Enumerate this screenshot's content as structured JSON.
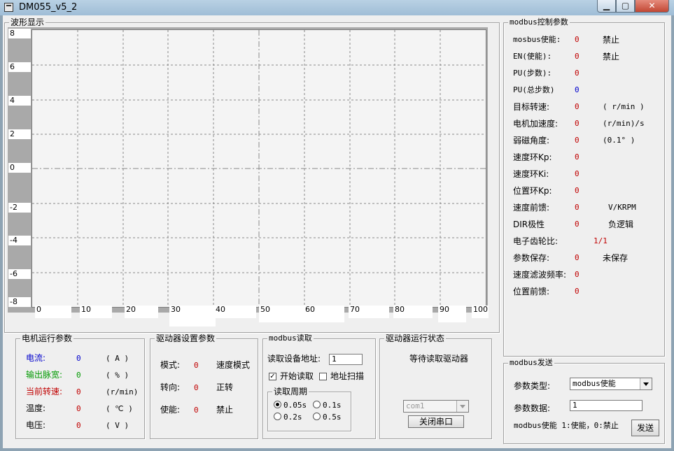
{
  "window": {
    "title": "DM055_v5_2"
  },
  "wave": {
    "legend": "波形显示",
    "y_ticks": [
      "8",
      "6",
      "4",
      "2",
      "0",
      "-2",
      "-4",
      "-6",
      "-8"
    ],
    "x_ticks": [
      "0",
      "10",
      "20",
      "30",
      "40",
      "50",
      "60",
      "70",
      "80",
      "90",
      "100"
    ]
  },
  "motor": {
    "legend": "电机运行参数",
    "rows": [
      {
        "label": "电流:",
        "value": "0",
        "unit": "( A )"
      },
      {
        "label": "输出脉宽:",
        "value": "0",
        "unit": "( % )"
      },
      {
        "label": "当前转速:",
        "value": "0",
        "unit": "(r/min)"
      },
      {
        "label": "温度:",
        "value": "0",
        "unit": "( ℃ )"
      },
      {
        "label": "电压:",
        "value": "0",
        "unit": "( V )"
      }
    ]
  },
  "driver_settings": {
    "legend": "驱动器设置参数",
    "rows": [
      {
        "label": "模式:",
        "value": "0",
        "desc": "速度模式"
      },
      {
        "label": "转向:",
        "value": "0",
        "desc": "正转"
      },
      {
        "label": "使能:",
        "value": "0",
        "desc": "禁止"
      }
    ]
  },
  "modbus_read": {
    "legend": "modbus读取",
    "address_label": "读取设备地址:",
    "address_value": "1",
    "start_read_label": "开始读取",
    "scan_label": "地址扫描",
    "period_legend": "读取周期",
    "periods": [
      "0.05s",
      "0.1s",
      "0.2s",
      "0.5s"
    ]
  },
  "driver_status": {
    "legend": "驱动器运行状态",
    "status_text": "等待读取驱动器",
    "port_value": "com1",
    "close_port_label": "关闭串口"
  },
  "modbus_control": {
    "legend": "modbus控制参数",
    "rows": [
      {
        "label": "mosbus使能:",
        "value": "0",
        "desc": "禁止"
      },
      {
        "label": "EN(使能):",
        "value": "0",
        "desc": "禁止"
      },
      {
        "label": "PU(步数):",
        "value": "0",
        "desc": ""
      },
      {
        "label": "PU(总步数)",
        "value": "0",
        "desc": ""
      },
      {
        "label": "目标转速:",
        "value": "0",
        "desc": "( r/min )"
      },
      {
        "label": "电机加速度:",
        "value": "0",
        "desc": "(r/min)/s"
      },
      {
        "label": "弱磁角度:",
        "value": "0",
        "desc": "(0.1° )"
      },
      {
        "label": "速度环Kp:",
        "value": "0",
        "desc": ""
      },
      {
        "label": "速度环Ki:",
        "value": "0",
        "desc": ""
      },
      {
        "label": "位置环Kp:",
        "value": "0",
        "desc": ""
      },
      {
        "label": "速度前馈:",
        "value": "0",
        "desc": "V/KRPM"
      },
      {
        "label": "DIR极性",
        "value": "0",
        "desc": "负逻辑"
      },
      {
        "label": "电子齿轮比:",
        "value": "1/1",
        "desc": ""
      },
      {
        "label": "参数保存:",
        "value": "0",
        "desc": "未保存"
      },
      {
        "label": "速度滤波频率:",
        "value": "0",
        "desc": ""
      },
      {
        "label": "位置前馈:",
        "value": "0",
        "desc": ""
      }
    ]
  },
  "modbus_send": {
    "legend": "modbus发送",
    "type_label": "参数类型:",
    "type_value": "modbus使能",
    "data_label": "参数数据:",
    "data_value": "1",
    "hint": "modbus使能 1:使能，0:禁止",
    "send_label": "发送"
  }
}
